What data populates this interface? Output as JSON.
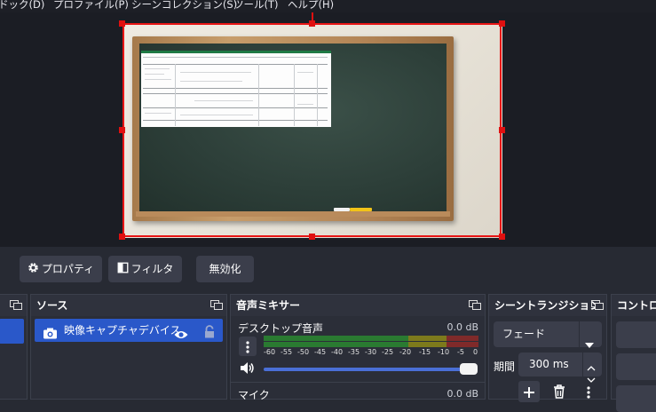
{
  "menu": [
    {
      "label": "ドック(D)"
    },
    {
      "label": "プロファイル(P)"
    },
    {
      "label": "シーンコレクション(S)"
    },
    {
      "label": "ツール(T)"
    },
    {
      "label": "ヘルプ(H)"
    }
  ],
  "toolbar": {
    "properties_label": "プロパティ",
    "filters_label": "フィルタ",
    "disable_label": "無効化"
  },
  "sources": {
    "title": "ソース",
    "items": [
      {
        "label": "映像キャプチャデバイス"
      }
    ]
  },
  "mixer": {
    "title": "音声ミキサー",
    "channels": [
      {
        "name": "デスクトップ音声",
        "level": "0.0 dB"
      },
      {
        "name": "マイク",
        "level": "0.0 dB"
      }
    ],
    "ticks": [
      "-60",
      "-55",
      "-50",
      "-45",
      "-40",
      "-35",
      "-30",
      "-25",
      "-20",
      "-15",
      "-10",
      "-5",
      "0"
    ]
  },
  "transitions": {
    "title": "シーントランジション",
    "selected": "フェード",
    "duration_label": "期間",
    "duration_value": "300 ms"
  },
  "controls": {
    "title": "コントロール"
  },
  "colors": {
    "selection": "#e81515",
    "accent": "#2a58c9"
  }
}
